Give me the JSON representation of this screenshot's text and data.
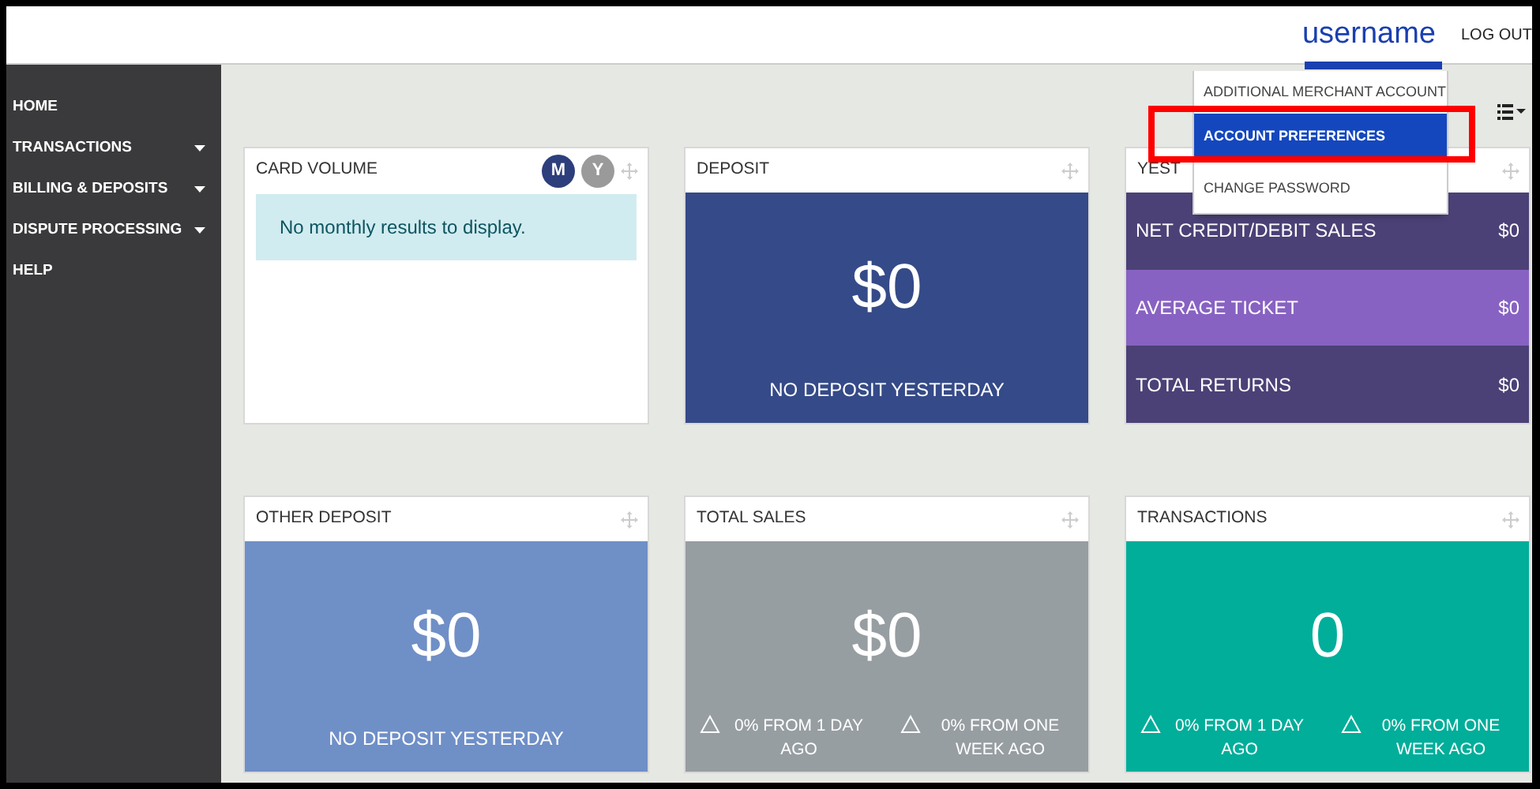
{
  "header": {
    "username": "username",
    "logout": "LOG OUT"
  },
  "user_menu": {
    "items": [
      {
        "label": "ADDITIONAL MERCHANT ACCOUNT",
        "selected": false
      },
      {
        "label": "ACCOUNT PREFERENCES",
        "selected": true
      },
      {
        "label": "CHANGE PASSWORD",
        "selected": false
      }
    ]
  },
  "sidebar": {
    "items": [
      {
        "label": "HOME",
        "expandable": false
      },
      {
        "label": "TRANSACTIONS",
        "expandable": true
      },
      {
        "label": "BILLING & DEPOSITS",
        "expandable": true
      },
      {
        "label": "DISPUTE PROCESSING",
        "expandable": true
      },
      {
        "label": "HELP",
        "expandable": false
      }
    ]
  },
  "widgets": [
    {
      "kind": "alert",
      "title": "CARD VOLUME",
      "toggles": [
        {
          "label": "M",
          "selected": true
        },
        {
          "label": "Y",
          "selected": false
        }
      ],
      "message": "No monthly results to display."
    },
    {
      "kind": "big",
      "title": "DEPOSIT",
      "color": "#354a88",
      "value": "$0",
      "caption": "NO DEPOSIT YESTERDAY"
    },
    {
      "kind": "list",
      "title": "YEST",
      "rows": [
        {
          "label": "NET CREDIT/DEBIT SALES",
          "value": "$0",
          "color": "#4b4176"
        },
        {
          "label": "AVERAGE TICKET",
          "value": "$0",
          "color": "#8862c2"
        },
        {
          "label": "TOTAL RETURNS",
          "value": "$0",
          "color": "#4b4176"
        }
      ]
    },
    {
      "kind": "big",
      "title": "OTHER DEPOSIT",
      "color": "#6f8fc7",
      "value": "$0",
      "caption": "NO DEPOSIT YESTERDAY"
    },
    {
      "kind": "stats",
      "title": "TOTAL SALES",
      "color": "#979ea2",
      "value": "$0",
      "stats": [
        "0% FROM 1 DAY AGO",
        "0% FROM ONE WEEK AGO"
      ]
    },
    {
      "kind": "stats",
      "title": "TRANSACTIONS",
      "color": "#00ae9a",
      "value": "0",
      "stats": [
        "0% FROM 1 DAY AGO",
        "0% FROM ONE WEEK AGO"
      ]
    }
  ]
}
